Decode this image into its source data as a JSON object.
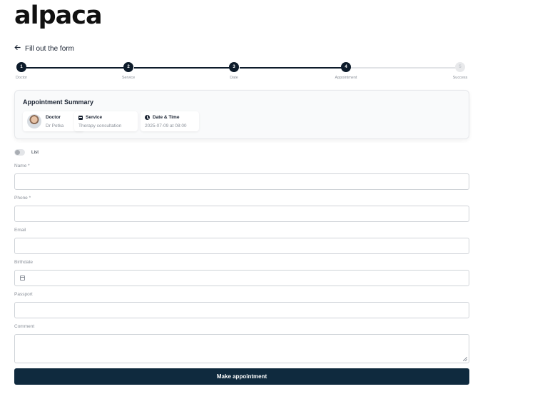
{
  "brand": {
    "logo_text": "alpaca"
  },
  "header": {
    "back_label": "Fill out the form"
  },
  "steps": [
    {
      "number": "1",
      "label": "Doctor",
      "state": "done"
    },
    {
      "number": "2",
      "label": "Service",
      "state": "done"
    },
    {
      "number": "3",
      "label": "Date",
      "state": "done"
    },
    {
      "number": "4",
      "label": "Appointment",
      "state": "current"
    },
    {
      "number": "5",
      "label": "Success",
      "state": "todo"
    }
  ],
  "summary": {
    "title": "Appointment Summary",
    "doctor": {
      "heading": "Doctor",
      "value": "Dr Petka"
    },
    "service": {
      "heading": "Service",
      "value": "Therapy consultation"
    },
    "datetime": {
      "heading": "Date & Time",
      "value": "2025-07-09 at 08:00"
    }
  },
  "toggle": {
    "label": "List",
    "on": false
  },
  "form": {
    "name_label": "Name *",
    "phone_label": "Phone *",
    "email_label": "Email",
    "birthdate_label": "Birthdate",
    "passport_label": "Passport",
    "comment_label": "Comment",
    "name_value": "",
    "phone_value": "",
    "email_value": "",
    "birthdate_value": "",
    "passport_value": "",
    "comment_value": ""
  },
  "actions": {
    "submit_label": "Make appointment"
  },
  "colors": {
    "primary": "#0f2a3e",
    "step_done": "#0d1b2a",
    "step_todo": "#e8e9eb",
    "muted_text": "#8a9099"
  },
  "icons": [
    "arrow-left-icon",
    "service-icon",
    "clock-icon",
    "calendar-icon"
  ]
}
